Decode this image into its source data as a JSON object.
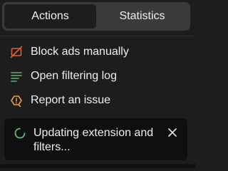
{
  "tabs": [
    {
      "label": "Actions",
      "active": true
    },
    {
      "label": "Statistics",
      "active": false
    }
  ],
  "menu": {
    "items": [
      {
        "label": "Block ads manually",
        "icon": "block-ads-icon",
        "color": "#e0603a"
      },
      {
        "label": "Open filtering log",
        "icon": "filtering-log-icon",
        "color": "#67b279"
      },
      {
        "label": "Report an issue",
        "icon": "report-issue-icon",
        "color": "#e8a13a"
      }
    ]
  },
  "toast": {
    "message": "Updating extension and filters...",
    "spinner_icon": "loading-spinner-icon",
    "spinner_color": "#67b279",
    "close_icon": "close-icon"
  },
  "colors": {
    "background": "#1d1d1d",
    "tab_track": "#3a3a3a",
    "text": "#f1f1f1",
    "toast_background": "#0f0f0f"
  }
}
